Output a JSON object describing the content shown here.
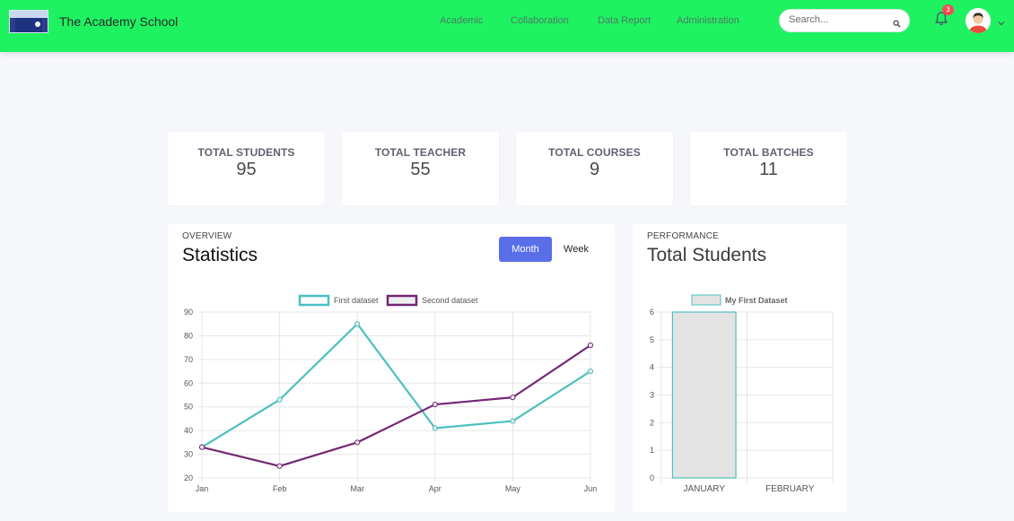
{
  "header": {
    "brand": "The Academy School",
    "nav": [
      "Academic",
      "Collaboration",
      "Data Report",
      "Administration"
    ],
    "search_placeholder": "Search...",
    "notification_count": "3",
    "colors": {
      "topbar": "#1ef261",
      "nav_text": "#4c7d64",
      "badge": "#f44c54"
    }
  },
  "stats": [
    {
      "label": "TOTAL STUDENTS",
      "value": "95"
    },
    {
      "label": "TOTAL TEACHER",
      "value": "55"
    },
    {
      "label": "TOTAL COURSES",
      "value": "9"
    },
    {
      "label": "TOTAL BATCHES",
      "value": "11"
    }
  ],
  "overview": {
    "eyebrow": "OVERVIEW",
    "title": "Statistics",
    "toggle": [
      "Month",
      "Week"
    ],
    "active_toggle": "Month"
  },
  "performance": {
    "eyebrow": "PERFORMANCE",
    "title": "Total Students"
  },
  "chart_data": [
    {
      "type": "line",
      "categories": [
        "Jan",
        "Feb",
        "Mar",
        "Apr",
        "May",
        "Jun"
      ],
      "series": [
        {
          "name": "First dataset",
          "values": [
            33,
            53,
            85,
            41,
            44,
            65
          ],
          "color": "#4bc0c0"
        },
        {
          "name": "Second dataset",
          "values": [
            33,
            25,
            35,
            51,
            54,
            76
          ],
          "color": "#742774"
        }
      ],
      "ylim": [
        20,
        90
      ],
      "yticks": [
        20,
        30,
        40,
        50,
        60,
        70,
        80,
        90
      ],
      "grid": true,
      "legend": "top-center"
    },
    {
      "type": "bar",
      "categories": [
        "JANUARY",
        "FEBRUARY"
      ],
      "series": [
        {
          "name": "My First Dataset",
          "values": [
            6,
            0
          ],
          "color": "#e3e3e3",
          "border": "#4bc0c0"
        }
      ],
      "ylim": [
        0,
        6
      ],
      "yticks": [
        0,
        1,
        2,
        3,
        4,
        5,
        6
      ],
      "grid": true,
      "legend": "top-center"
    }
  ]
}
